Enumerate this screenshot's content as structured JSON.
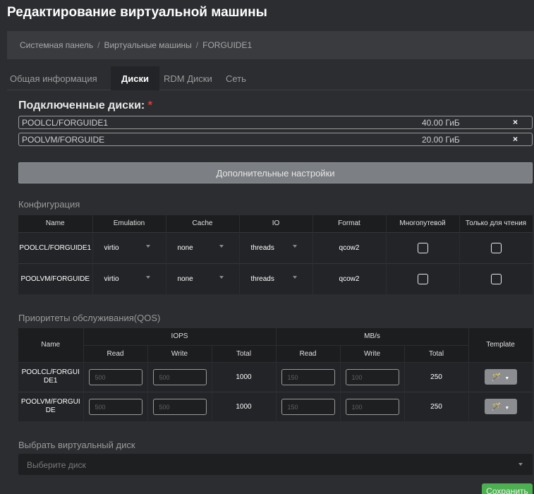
{
  "page": {
    "title": "Редактирование виртуальной машины"
  },
  "breadcrumb": {
    "items": [
      "Системная панель",
      "Виртуальные машины",
      "FORGUIDE1"
    ]
  },
  "tabs": [
    "Общая информация",
    "Диски",
    "RDM Диски",
    "Сеть"
  ],
  "active_tab": "Диски",
  "disks": {
    "heading": "Подключенные диски:",
    "required_mark": "*",
    "items": [
      {
        "name": "POOLCL/FORGUIDE1",
        "size": "40.00 ГиБ",
        "remove": "×"
      },
      {
        "name": "POOLVM/FORGUIDE",
        "size": "20.00 ГиБ",
        "remove": "×"
      }
    ]
  },
  "more_settings_label": "Дополнительные настройки",
  "config": {
    "heading": "Конфигурация",
    "headers": [
      "Name",
      "Emulation",
      "Cache",
      "IO",
      "Format",
      "Многопутевой",
      "Только для чтения"
    ],
    "rows": [
      {
        "name": "POOLCL/FORGUIDE1",
        "emulation": "virtio",
        "cache": "none",
        "io": "threads",
        "format": "qcow2",
        "multipath": false,
        "readonly": false
      },
      {
        "name": "POOLVM/FORGUIDE",
        "emulation": "virtio",
        "cache": "none",
        "io": "threads",
        "format": "qcow2",
        "multipath": false,
        "readonly": false
      }
    ]
  },
  "qos": {
    "heading": "Приоритеты обслуживания(QOS)",
    "headers": {
      "name": "Name",
      "iops": "IOPS",
      "mbs": "MB/s",
      "template": "Template",
      "read": "Read",
      "write": "Write",
      "total": "Total"
    },
    "rows": [
      {
        "name": "POOLCL/FORGUI DE1",
        "iops_read": "500",
        "iops_write": "500",
        "iops_total": "1000",
        "mb_read": "150",
        "mb_write": "100",
        "mb_total": "250"
      },
      {
        "name": "POOLVM/FORGUI DE",
        "iops_read": "500",
        "iops_write": "500",
        "iops_total": "1000",
        "mb_read": "150",
        "mb_write": "100",
        "mb_total": "250"
      }
    ]
  },
  "vdisk": {
    "label": "Выбрать виртуальный диск",
    "placeholder": "Выберите диск"
  },
  "save_label": "Сохранить",
  "colors": {
    "background": "#2b2d30",
    "table_header": "#1c1d1f",
    "table_row": "#232427",
    "save": "#4caf50",
    "required": "#e03a3a"
  }
}
